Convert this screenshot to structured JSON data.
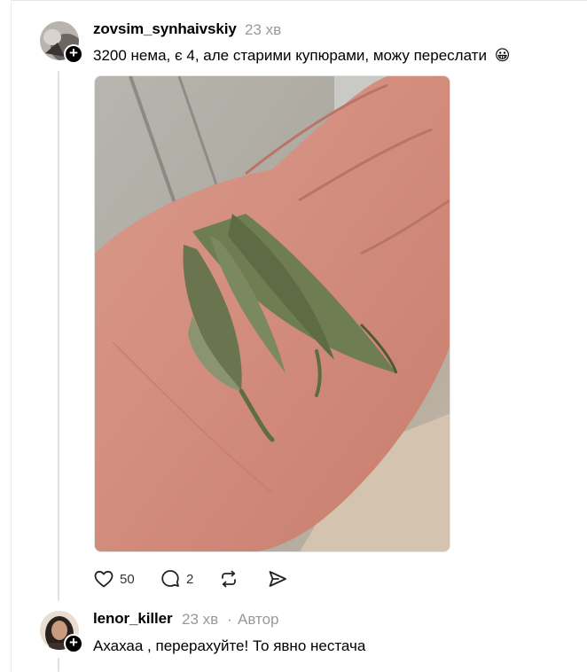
{
  "post": {
    "username": "zovsim_synhaivskiy",
    "time": "23 хв",
    "text": "3200 нема, є 4, але старими купюрами, можу переслати",
    "emoji": "😀",
    "image_icon": "photo-hand-with-dried-leaves",
    "actions": {
      "likes": "50",
      "replies": "2",
      "repost_icon": "repost-icon",
      "share_icon": "share-icon"
    }
  },
  "reply": {
    "username": "lenor_killer",
    "time": "23 хв",
    "separator": "·",
    "author_label": "Автор",
    "text": "Ахахаа , перерахуйте! То явно нестача"
  },
  "follow_symbol": "+"
}
